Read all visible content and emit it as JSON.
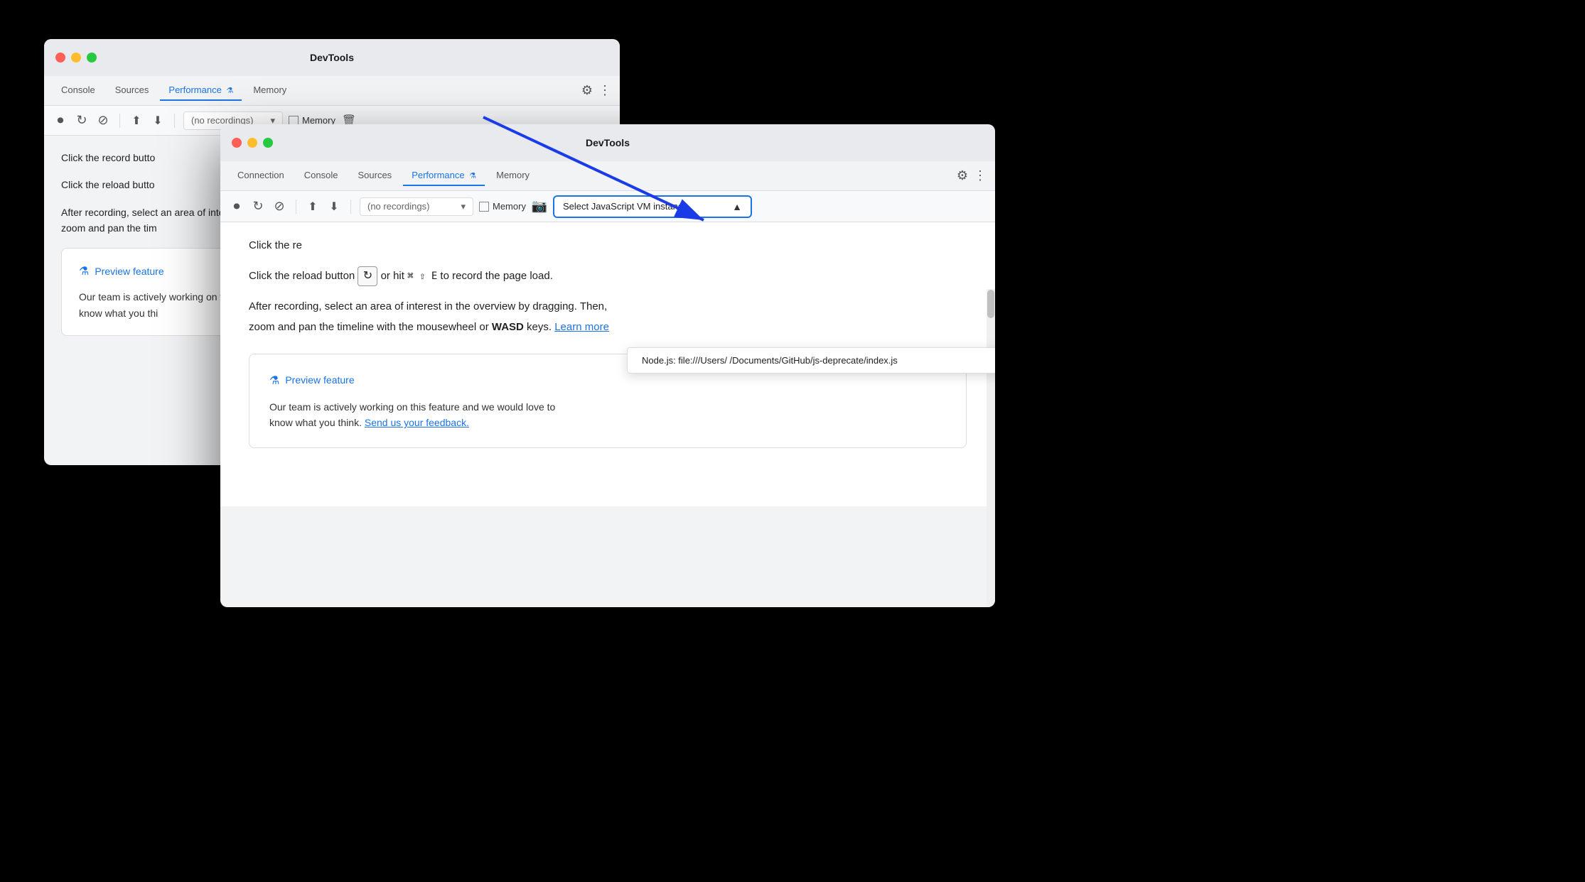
{
  "background": {
    "color": "#000000"
  },
  "window_back": {
    "title": "DevTools",
    "traffic_lights": [
      "red",
      "yellow",
      "green"
    ],
    "tabs": [
      {
        "label": "Console",
        "active": false
      },
      {
        "label": "Sources",
        "active": false
      },
      {
        "label": "Performance",
        "active": true,
        "flask": true
      },
      {
        "label": "Memory",
        "active": false
      }
    ],
    "toolbar": {
      "record_label": "⏺",
      "reload_label": "↻",
      "clear_label": "⊘",
      "upload_label": "⬆",
      "download_label": "⬇",
      "recordings_placeholder": "(no recordings)",
      "memory_label": "Memory",
      "delete_label": "🗑"
    },
    "content": {
      "click_record": "Click the record butto",
      "click_reload": "Click the reload butto",
      "after_recording": "After recording, select an area of interest in the overview by dragging. Then,\nzoom and pan the tim"
    },
    "preview_box": {
      "title": "Preview feature",
      "body": "Our team is actively working on this feature and we would love to\nknow what you thi"
    }
  },
  "window_front": {
    "title": "DevTools",
    "traffic_lights": [
      "red",
      "yellow",
      "green"
    ],
    "tabs": [
      {
        "label": "Connection",
        "active": false
      },
      {
        "label": "Console",
        "active": false
      },
      {
        "label": "Sources",
        "active": false
      },
      {
        "label": "Performance",
        "active": true,
        "flask": true
      },
      {
        "label": "Memory",
        "active": false
      }
    ],
    "toolbar": {
      "record_label": "⏺",
      "reload_label": "↻",
      "clear_label": "⊘",
      "upload_label": "⬆",
      "download_label": "⬇",
      "recordings_placeholder": "(no recordings)",
      "memory_label": "Memory",
      "capture_heap_label": "📷",
      "vm_dropdown_label": "Select JavaScript VM instance",
      "vm_dropdown_arrow": "▲"
    },
    "dropdown": {
      "item": "Node.js: file:///Users/         /Documents/GitHub/js-deprecate/index.js"
    },
    "content": {
      "click_record_text": "Click the re",
      "click_reload_text": "Click the reload button",
      "hit_text": "or hit ⌘ ⇧ E to record the page load.",
      "after_recording_text": "After recording, select an area of interest in the overview by dragging. Then,",
      "after_recording_text2": "zoom and pan the timeline with the mousewheel or",
      "bold_text": "WASD",
      "keys_text": "keys.",
      "learn_more": "Learn more"
    },
    "preview_box": {
      "title": "Preview feature",
      "body_start": "Our team is actively working on this feature and we would love to",
      "body_end": "know what you think.",
      "feedback_link": "Send us your feedback."
    }
  },
  "icons": {
    "record": "⏺",
    "reload": "↻",
    "cancel": "⊘",
    "upload": "⬆",
    "download": "⬇",
    "settings": "⚙",
    "more": "⋮",
    "flask": "⚗",
    "trash": "🗑",
    "chevron_down": "▾",
    "chevron_up": "▲",
    "camera": "📷"
  }
}
